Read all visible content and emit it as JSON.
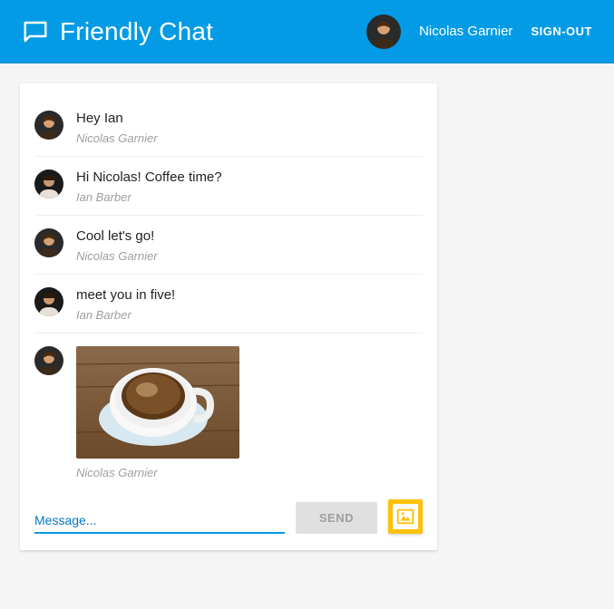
{
  "header": {
    "title": "Friendly Chat",
    "user_name": "Nicolas Garnier",
    "signout_label": "SIGN-OUT"
  },
  "messages": [
    {
      "text": "Hey Ian",
      "author": "Nicolas Garnier",
      "avatar": "nicolas"
    },
    {
      "text": "Hi Nicolas! Coffee time?",
      "author": "Ian Barber",
      "avatar": "ian"
    },
    {
      "text": "Cool let's go!",
      "author": "Nicolas Garnier",
      "avatar": "nicolas"
    },
    {
      "text": "meet you in five!",
      "author": "Ian Barber",
      "avatar": "ian"
    },
    {
      "image": "coffee",
      "author": "Nicolas Garnier",
      "avatar": "nicolas"
    }
  ],
  "compose": {
    "placeholder": "Message...",
    "value": "",
    "send_label": "SEND"
  }
}
